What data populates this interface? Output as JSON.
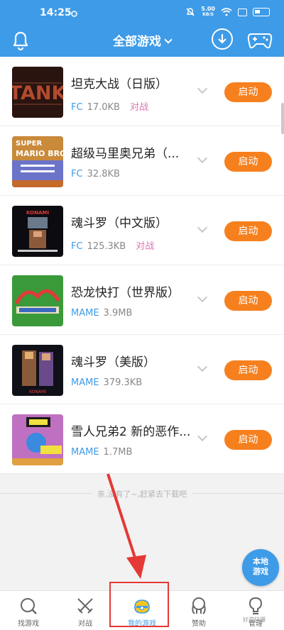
{
  "status_bar": {
    "time": "14:25",
    "net_speed": "5.00",
    "net_unit": "KB/S"
  },
  "header": {
    "title": "全部游戏",
    "icons": [
      "bell-icon",
      "download-icon",
      "gamepad-icon"
    ]
  },
  "games": [
    {
      "name": "坦克大战（日版）",
      "platform": "FC",
      "size": "17.0KB",
      "battle": "对战",
      "launch": "启动",
      "thumb": "tank"
    },
    {
      "name": "超级马里奥兄弟（...",
      "platform": "FC",
      "size": "32.8KB",
      "battle": "",
      "launch": "启动",
      "thumb": "mario"
    },
    {
      "name": "魂斗罗（中文版）",
      "platform": "FC",
      "size": "125.3KB",
      "battle": "对战",
      "launch": "启动",
      "thumb": "contra"
    },
    {
      "name": "恐龙快打（世界版）",
      "platform": "MAME",
      "size": "3.9MB",
      "battle": "",
      "launch": "启动",
      "thumb": "dino"
    },
    {
      "name": "魂斗罗（美版）",
      "platform": "MAME",
      "size": "379.3KB",
      "battle": "",
      "launch": "启动",
      "thumb": "contra2"
    },
    {
      "name": "雪人兄弟2 新的恶作...",
      "platform": "MAME",
      "size": "1.7MB",
      "battle": "",
      "launch": "启动",
      "thumb": "snow"
    }
  ],
  "footer_note": "亲,没有了~,赶紧去下载吧",
  "local_games_button": {
    "line1": "本地",
    "line2": "游戏"
  },
  "tabs": [
    {
      "label": "找游戏",
      "icon": "search-icon"
    },
    {
      "label": "对战",
      "icon": "crossed-swords-icon"
    },
    {
      "label": "我的游戏",
      "icon": "gamepad-icon",
      "active": true
    },
    {
      "label": "赞助",
      "icon": "sponsor-icon"
    },
    {
      "label": "管理",
      "icon": "manage-icon"
    }
  ],
  "watermark": "好游快爆",
  "colors": {
    "primary": "#3e9be7",
    "launch": "#f7801e",
    "battle": "#e074b5",
    "annotation": "#e53935"
  }
}
